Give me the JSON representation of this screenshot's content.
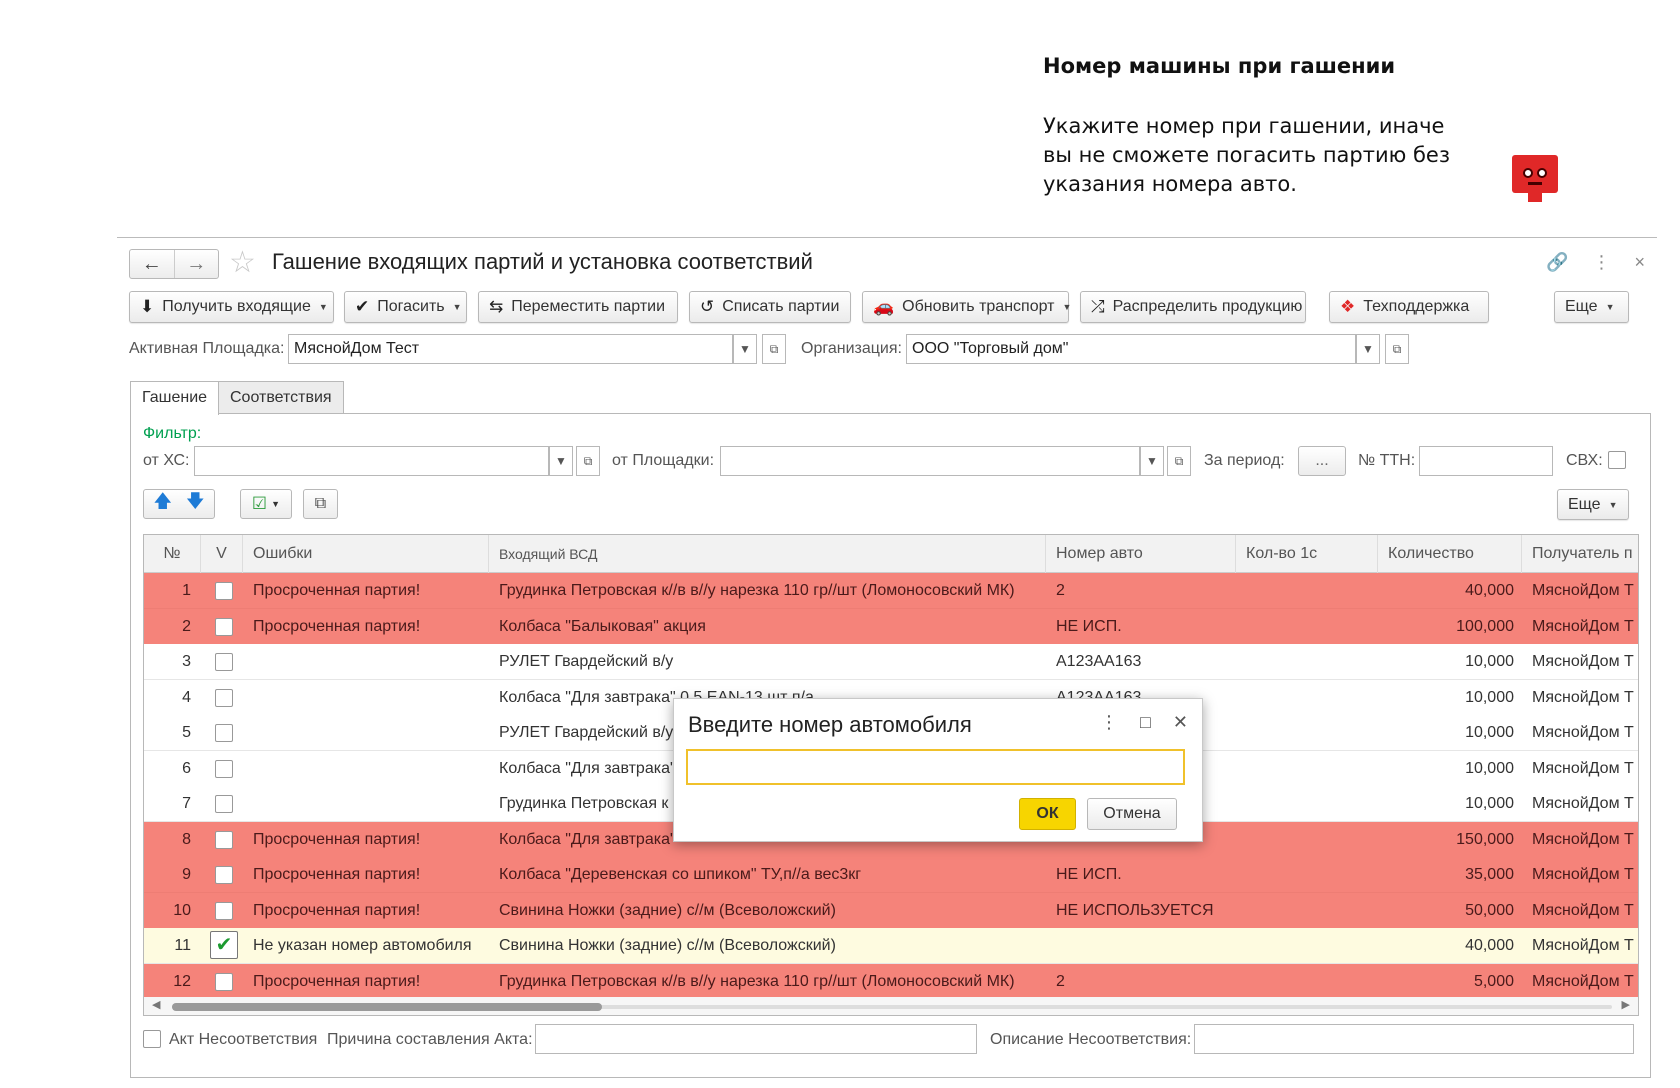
{
  "annotation": {
    "title": "Номер машины при гашении",
    "text": "Укажите номер при гашении, иначе вы не сможете погасить партию без указания номера авто."
  },
  "window": {
    "title": "Гашение входящих партий и установка соответствий",
    "back_icon": "←",
    "forward_icon": "→",
    "star_icon": "☆",
    "link_icon": "🔗",
    "menu_icon": "⋮",
    "close_icon": "×"
  },
  "toolbar": {
    "get_incoming": "Получить входящие",
    "redeem": "Погасить",
    "move_batches": "Переместить партии",
    "write_off": "Списать партии",
    "update_transport": "Обновить транспорт",
    "distribute": "Распределить продукцию",
    "support": "Техподдержка",
    "more": "Еще"
  },
  "form": {
    "active_site_label": "Активная Площадка:",
    "active_site_value": "МяснойДом Тест",
    "org_label": "Организация:",
    "org_value": "ООО \"Торговый дом\""
  },
  "tabs": [
    "Гашение",
    "Соответствия"
  ],
  "filter": {
    "title": "Фильтр:",
    "from_xc": "от ХС:",
    "from_site": "от Площадки:",
    "period": "За период:",
    "period_btn": "...",
    "ttn": "№ ТТН:",
    "svh": "СВХ:"
  },
  "table_toolbar": {
    "more": "Еще"
  },
  "table": {
    "columns": [
      "№",
      "V",
      "Ошибки",
      "Входящий ВСД",
      "Номер авто",
      "Кол-во 1с",
      "Количество",
      "Получатель п"
    ],
    "rows": [
      {
        "n": "1",
        "err": "Просроченная партия!",
        "vsd": "Грудинка Петровская к//в в//у нарезка 110 гр//шт (Ломоносовский МК)",
        "auto": "2",
        "qty": "40,000",
        "recv": "МяснойДом Т",
        "style": "err",
        "checked": false
      },
      {
        "n": "2",
        "err": "Просроченная партия!",
        "vsd": "Колбаса \"Балыковая\" акция",
        "auto": "НЕ ИСП.",
        "qty": "100,000",
        "recv": "МяснойДом Т",
        "style": "err",
        "checked": false
      },
      {
        "n": "3",
        "err": "",
        "vsd": "РУЛЕТ Гвардейский в/у",
        "auto": "А123АА163",
        "qty": "10,000",
        "recv": "МяснойДом Т",
        "style": "ok",
        "checked": false
      },
      {
        "n": "4",
        "err": "",
        "vsd": "Колбаса \"Для завтрака\" 0,5 EAN-13 шт п/а",
        "auto": "А123АА163",
        "qty": "10,000",
        "recv": "МяснойДом Т",
        "style": "ok",
        "checked": false
      },
      {
        "n": "5",
        "err": "",
        "vsd": "РУЛЕТ Гвардейский в/у",
        "auto": "",
        "qty": "10,000",
        "recv": "МяснойДом Т",
        "style": "ok",
        "checked": false
      },
      {
        "n": "6",
        "err": "",
        "vsd": "Колбаса \"Для завтрака\"",
        "auto": "",
        "qty": "10,000",
        "recv": "МяснойДом Т",
        "style": "ok",
        "checked": false
      },
      {
        "n": "7",
        "err": "",
        "vsd": "Грудинка Петровская к",
        "auto": "",
        "qty": "10,000",
        "recv": "МяснойДом Т",
        "style": "ok",
        "checked": false
      },
      {
        "n": "8",
        "err": "Просроченная партия!",
        "vsd": "Колбаса \"Для завтрака\"",
        "auto": "",
        "qty": "150,000",
        "recv": "МяснойДом Т",
        "style": "err",
        "checked": false
      },
      {
        "n": "9",
        "err": "Просроченная партия!",
        "vsd": "Колбаса \"Деревенская со шпиком\" ТУ,п//а вес3кг",
        "auto": "НЕ ИСП.",
        "qty": "35,000",
        "recv": "МяснойДом Т",
        "style": "err",
        "checked": false
      },
      {
        "n": "10",
        "err": "Просроченная партия!",
        "vsd": "Свинина Ножки (задние) с//м (Всеволожский)",
        "auto": "НЕ ИСПОЛЬЗУЕТСЯ",
        "qty": "50,000",
        "recv": "МяснойДом Т",
        "style": "err",
        "checked": false
      },
      {
        "n": "11",
        "err": "Не указан номер автомобиля",
        "vsd": "Свинина Ножки (задние) с//м (Всеволожский)",
        "auto": "",
        "qty": "40,000",
        "recv": "МяснойДом Т",
        "style": "sel",
        "checked": true
      },
      {
        "n": "12",
        "err": "Просроченная партия!",
        "vsd": "Грудинка Петровская к//в в//у нарезка 110 гр//шт (Ломоносовский МК)",
        "auto": "2",
        "qty": "5,000",
        "recv": "МяснойДом Т",
        "style": "err",
        "checked": false
      }
    ]
  },
  "footer": {
    "act": "Акт Несоответствия",
    "reason": "Причина составления Акта:",
    "description": "Описание Несоответствия:"
  },
  "modal": {
    "title": "Введите номер автомобиля",
    "input_value": "",
    "ok": "ОК",
    "cancel": "Отмена"
  },
  "colors": {
    "error_row": "#f5837a",
    "selected_row": "#fefbe0",
    "accent_yellow": "#f7d500",
    "filter_green": "#00a050"
  }
}
